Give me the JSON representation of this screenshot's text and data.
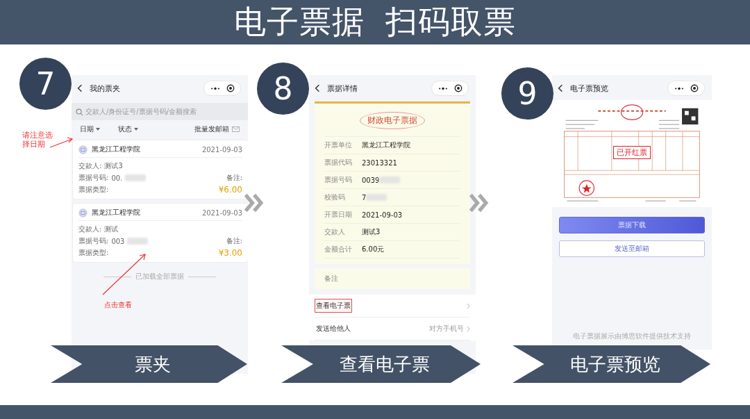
{
  "title": [
    "电子票据",
    "扫码取票"
  ],
  "steps": [
    {
      "number": "7",
      "label": "票夹",
      "screen": {
        "kind": "list",
        "nav_title": "我的票夹",
        "search": {
          "placeholder": "交款人/身份证号/票据号码/金额搜索"
        },
        "filters": [
          "日期",
          "状态"
        ],
        "batch_label": "批量发邮箱",
        "cards": [
          {
            "org": "黑龙江工程学院",
            "date": "2021-09-03",
            "payer_label": "交款人:",
            "payer": "测试3",
            "number_label": "票据号码:",
            "number": "00.",
            "remark_label": "备注:",
            "type_label": "票据类型:",
            "amount": "¥6.00"
          },
          {
            "org": "黑龙江工程学院",
            "date": "2021-09-03",
            "payer_label": "交款人:",
            "payer": "测试",
            "number_label": "票据号码:",
            "number": "003",
            "remark_label": "备注:",
            "type_label": "票据类型:",
            "amount": "¥3.00"
          }
        ],
        "end_note": "已加载全部票据"
      },
      "annotations": [
        "请注意选择日期",
        "点击查看"
      ]
    },
    {
      "number": "8",
      "label": "查看电子票",
      "screen": {
        "kind": "detail",
        "nav_title": "票据详情",
        "ticket_title": "财政电子票据",
        "fields": [
          {
            "label": "开票单位",
            "value": "黑龙江工程学院",
            "redacted": false
          },
          {
            "label": "票据代码",
            "value": "23013321",
            "redacted": false
          },
          {
            "label": "票据号码",
            "value": "0039",
            "redacted": true
          },
          {
            "label": "校验码",
            "value": "7",
            "redacted": true
          },
          {
            "label": "开票日期",
            "value": "2021-09-03",
            "redacted": false
          },
          {
            "label": "交款人",
            "value": "测试3",
            "redacted": false
          },
          {
            "label": "金额合计",
            "value": "6.00元",
            "redacted": false
          }
        ],
        "remark_label": "备注",
        "menu": [
          {
            "label": "查看电子票",
            "highlighted": true
          },
          {
            "label": "发送给他人",
            "hint": "对方手机号",
            "highlighted": false
          }
        ]
      }
    },
    {
      "number": "9",
      "label": "电子票预览",
      "screen": {
        "kind": "preview",
        "nav_title": "电子票预览",
        "stamp": "已开红票",
        "buttons": [
          {
            "label": "票据下载",
            "primary": true
          },
          {
            "label": "发送至邮箱",
            "primary": false
          }
        ],
        "footer": "电子票据展示由博思软件提供技术支持"
      }
    }
  ]
}
